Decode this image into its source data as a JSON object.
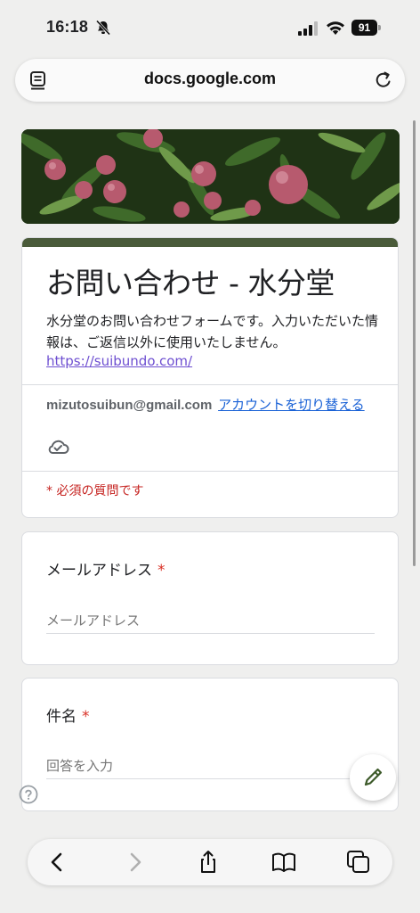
{
  "status": {
    "time": "16:18",
    "battery": "91"
  },
  "browser": {
    "url": "docs.google.com"
  },
  "form": {
    "title": "お問い合わせ - 水分堂",
    "description": "水分堂のお問い合わせフォームです。入力いただいた情報は、ご返信以外に使用いたしません。",
    "link": "https://suibundo.com/",
    "account_email": "mizutosuibun@gmail.com",
    "switch_account": "アカウントを切り替える",
    "required_note": "* 必須の質問です",
    "questions": [
      {
        "label": "メールアドレス",
        "required": "*",
        "placeholder": "メールアドレス"
      },
      {
        "label": "件名",
        "required": "*",
        "placeholder": "回答を入力"
      }
    ]
  },
  "colors": {
    "accent": "#4a5b3a",
    "link": "#6e4fd1",
    "required": "#d93025"
  },
  "icons": [
    "bell-slash-icon",
    "signal-icon",
    "wifi-icon",
    "battery-icon",
    "reader-mode-icon",
    "reload-icon",
    "cloud-check-icon",
    "edit-pencil-icon",
    "help-icon",
    "back-icon",
    "forward-icon",
    "share-icon",
    "bookmarks-icon",
    "tabs-icon"
  ]
}
